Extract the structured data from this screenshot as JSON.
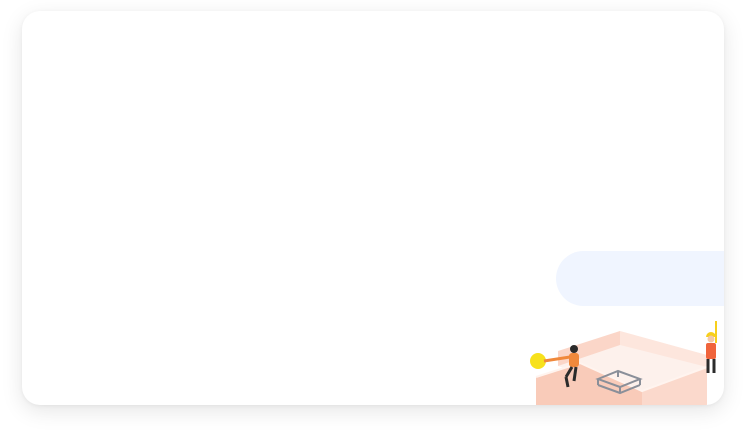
{
  "colors": {
    "card_background": "#ffffff",
    "pill_background": "#f0f5ff",
    "wall_light": "#fde3da",
    "wall_mid": "#f9c9b8",
    "floor": "#fdf1ec",
    "worker_shirt": "#f0643c",
    "ball": "#f7e11c",
    "helmet": "#f7cf1c"
  },
  "illustration": {
    "icon": "construction-workers-illustration"
  }
}
